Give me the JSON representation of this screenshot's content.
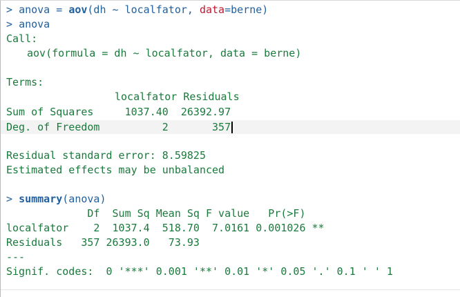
{
  "console": {
    "prompt": ">",
    "cmd1": {
      "lhs": "anova",
      "op": " = ",
      "func": "aov",
      "args_a": "(dh ~ localfator, ",
      "arg_name": "data",
      "args_b": "=berne)"
    },
    "cmd2": "anova",
    "call_label": "Call:",
    "call_text": "aov(formula = dh ~ localfator, data = berne)",
    "terms_label": "Terms:",
    "terms_header": "localfator Residuals",
    "sum_sq_row": "Sum of Squares     1037.40  26392.97",
    "df_row": "Deg. of Freedom          2       357",
    "resid_se": "Residual standard error: 8.59825",
    "unbalanced": "Estimated effects may be unbalanced",
    "cmd3": {
      "func": "summary",
      "args": "(anova)"
    },
    "summary_header": "             Df  Sum Sq Mean Sq F value   Pr(>F)",
    "summary_row1": "localfator    2  1037.4  518.70  7.0161 0.001026 **",
    "summary_row2": "Residuals   357 26393.0   73.93",
    "separator": "---",
    "signif": "Signif. codes:  0 '***' 0.001 '**' 0.01 '*' 0.05 '.' 0.1 ' ' 1"
  },
  "colors": {
    "input": "#1f5f9e",
    "output": "#1a7a3c",
    "argument": "#c0182f"
  }
}
